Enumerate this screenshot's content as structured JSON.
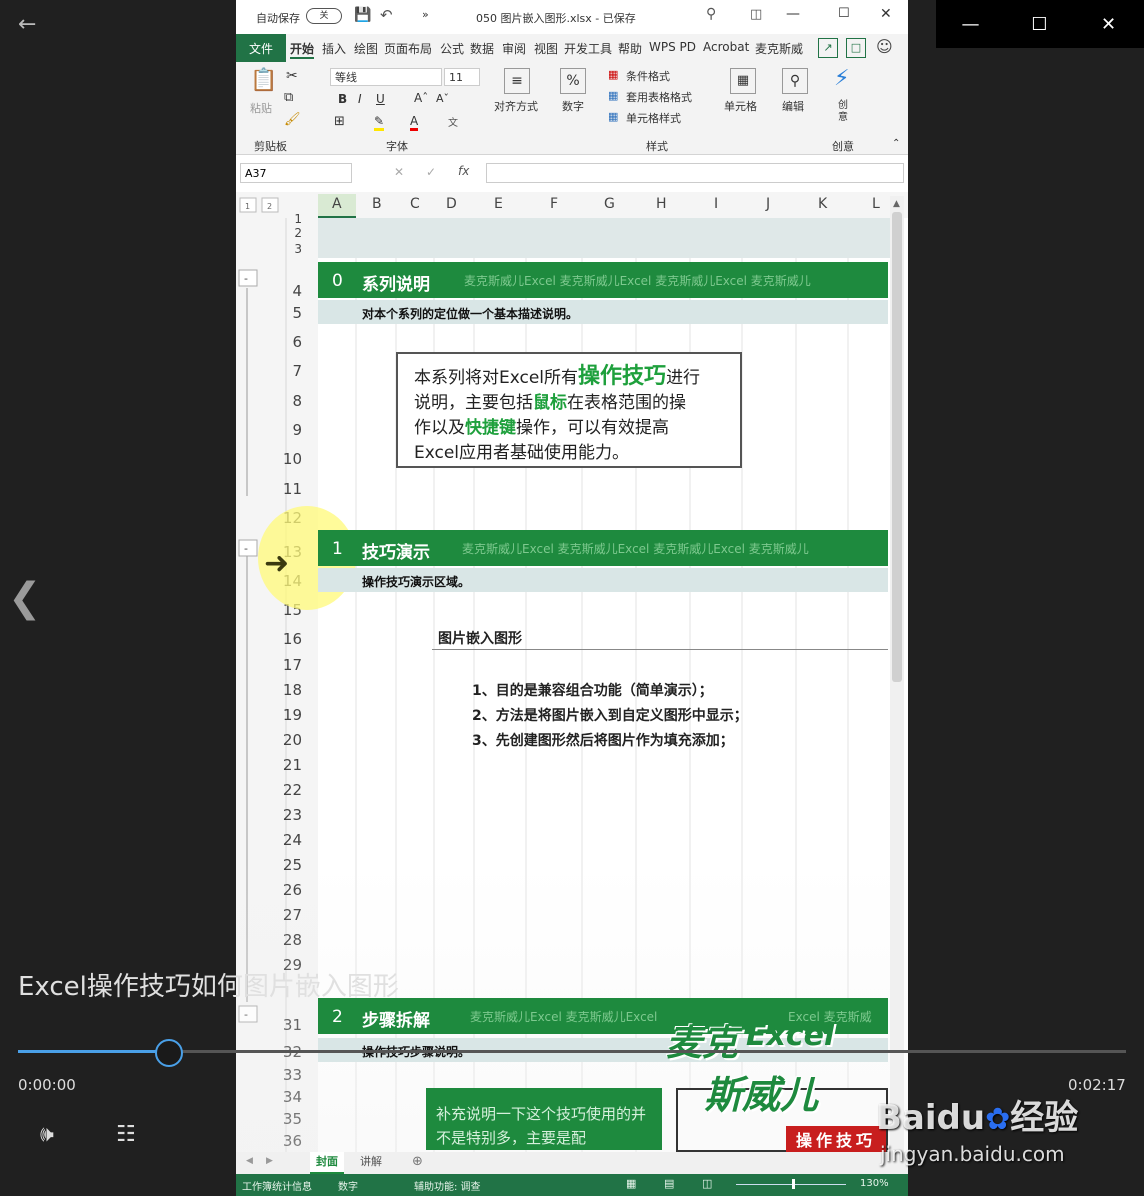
{
  "player": {
    "video_title": "Excel操作技巧如何图片嵌入图形",
    "time_current": "0:00:00",
    "time_total": "0:02:17",
    "progress_fraction": 0.0,
    "accent_color": "#4aa0e8"
  },
  "excel": {
    "autosave_label": "自动保存",
    "autosave_state": "关",
    "file_title": "050 图片嵌入图形.xlsx - 已保存",
    "menu": [
      "文件",
      "开始",
      "插入",
      "绘图",
      "页面布局",
      "公式",
      "数据",
      "审阅",
      "视图",
      "开发工具",
      "帮助",
      "WPS PD",
      "Acrobat",
      "麦克斯威"
    ],
    "ribbon": {
      "paste": "粘贴",
      "clipboard": "剪贴板",
      "font_name": "等线",
      "font_size": "11",
      "font_group": "字体",
      "align": "对齐方式",
      "number": "数字",
      "cond_format": "条件格式",
      "table_format": "套用表格格式",
      "cell_style": "单元格样式",
      "style_group": "样式",
      "cells": "单元格",
      "edit": "编辑",
      "creative": "创意",
      "creative_btn": "创\n意"
    },
    "name_box": "A37",
    "columns": [
      "A",
      "B",
      "C",
      "D",
      "E",
      "F",
      "G",
      "H",
      "I",
      "J",
      "K",
      "L"
    ],
    "rows": [
      "1",
      "2",
      "3",
      "4",
      "5",
      "6",
      "7",
      "8",
      "9",
      "10",
      "11",
      "12",
      "13",
      "14",
      "15",
      "16",
      "17",
      "18",
      "19",
      "20",
      "21",
      "22",
      "23",
      "24",
      "25",
      "26",
      "27",
      "28",
      "29",
      "30",
      "31",
      "32",
      "33",
      "34",
      "35",
      "36"
    ],
    "section0": {
      "num": "0",
      "title": "系列说明",
      "watermark": "麦克斯威儿Excel 麦克斯威儿Excel 麦克斯威儿Excel 麦克斯威儿",
      "desc": "对本个系列的定位做一个基本描述说明。"
    },
    "box_text": {
      "line1a": "本系列将对Excel所有",
      "line1b": "操作技巧",
      "line1c": "进行",
      "line2a": "说明，主要包括",
      "line2b": "鼠标",
      "line2c": "在表格范围的操",
      "line3a": "作以及",
      "line3b": "快捷键",
      "line3c": "操作，可以有效提高",
      "line4": "Excel应用者基础使用能力。"
    },
    "section1": {
      "num": "1",
      "title": "技巧演示",
      "watermark": "麦克斯威儿Excel 麦克斯威儿Excel 麦克斯威儿Excel 麦克斯威儿",
      "desc": "操作技巧演示区域。"
    },
    "demo_heading": "图片嵌入图形",
    "demo_points": [
      "1、目的是兼容组合功能（简单演示）；",
      "2、方法是将图片嵌入到自定义图形中显示；",
      "3、先创建图形然后将图片作为填充添加；"
    ],
    "section2": {
      "num": "2",
      "title": "步骤拆解",
      "watermark": "麦克斯威儿Excel 麦克斯威儿Excel",
      "desc": "操作技巧步骤说明。",
      "watermark_right": "Excel 麦克斯威"
    },
    "note_text": "补充说明一下这个技巧使用的并不是特别多，主要是配",
    "logo_line1": "麦克",
    "logo_line1b": "Excel",
    "logo_line2": "斯威儿",
    "badge": "操作技巧",
    "sheet_tabs": [
      "封面",
      "讲解"
    ],
    "status": [
      "工作簿统计信息",
      "数字",
      "辅助功能: 调查"
    ],
    "zoom": "130%",
    "accent_green": "#217346",
    "band_green": "#1e8a3e",
    "highlight_green": "#1ea03c"
  },
  "baidu": {
    "brand": "Baidu",
    "jingyan": "经验",
    "url": "jingyan.baidu.com"
  }
}
